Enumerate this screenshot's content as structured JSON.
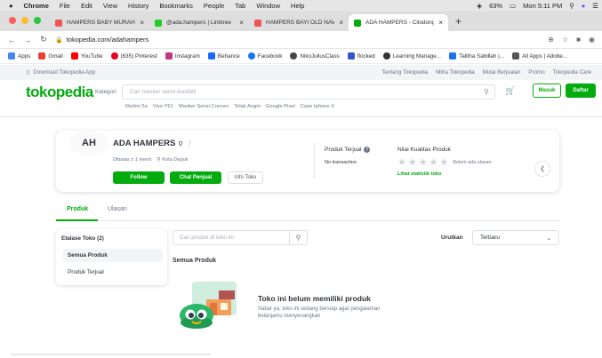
{
  "mac_menu": {
    "apple": "",
    "items": [
      "Chrome",
      "File",
      "Edit",
      "View",
      "History",
      "Bookmarks",
      "People",
      "Tab",
      "Window",
      "Help"
    ],
    "battery": "63%",
    "clock": "Mon 5:11 PM"
  },
  "browser": {
    "tabs": [
      {
        "title": "HAMPERS BABY MURAH BERK",
        "color": "#e55"
      },
      {
        "title": "@ada.hampers | Linktree",
        "color": "#2c2"
      },
      {
        "title": "HAMPERS BAYI OLD NAVY MU",
        "color": "#e55"
      },
      {
        "title": "ADA HAMPERS - Cilodong, Ko",
        "color": "#03ac0e"
      }
    ],
    "url": "tokopedia.com/adahampers",
    "bookmarks": [
      {
        "label": "Apps",
        "color": "#4285f4"
      },
      {
        "label": "Gmail",
        "color": "#ea4335"
      },
      {
        "label": "YouTube",
        "color": "#ff0000"
      },
      {
        "label": "(635) Pinterest",
        "color": "#e60023"
      },
      {
        "label": "Instagram",
        "color": "#c13584"
      },
      {
        "label": "Behance",
        "color": "#1769ff"
      },
      {
        "label": "Facebook",
        "color": "#1877f2"
      },
      {
        "label": "NikoJuliusClass",
        "color": "#444"
      },
      {
        "label": "flocked",
        "color": "#3355cc"
      },
      {
        "label": "Learning Manage...",
        "color": "#333"
      },
      {
        "label": "Talitha Sabillah |...",
        "color": "#1a73e8"
      },
      {
        "label": "All Apps | Adobe...",
        "color": "#555"
      }
    ]
  },
  "topbar": {
    "download": "Download Tokopedia App",
    "links": [
      "Tentang Tokopedia",
      "Mitra Tokopedia",
      "Mulai Berjualan",
      "Promo",
      "Tokopedia Care"
    ]
  },
  "header": {
    "logo": "tokopedia",
    "kategori": "Kategori",
    "search_placeholder": "Cari masker sensi duckbill",
    "masuk": "Masuk",
    "daftar": "Daftar",
    "keywords": [
      "Redmi 5a",
      "Vivo Y51",
      "Masker Sensi Convex",
      "Tolak Angin",
      "Google Pixel",
      "Case Iphone X"
    ]
  },
  "shop": {
    "avatar": "AH",
    "name": "ADA HAMPERS",
    "status": "Dibalas ± 1 menit",
    "location": "Kota Depok",
    "follow": "Follow",
    "chat": "Chat Penjual",
    "info": "Info Toko",
    "produk_terjual_label": "Produk Terjual",
    "produk_terjual_value": "No transaction",
    "nilai_label": "Nilai Kualitas Produk",
    "nilai_value": "Belum ada ulasan",
    "lihat": "Lihat statistik toko"
  },
  "page_tabs": {
    "produk": "Produk",
    "ulasan": "Ulasan"
  },
  "etalase": {
    "title": "Etalase Toko (2)",
    "items": [
      "Semua Produk",
      "Produk Terjual"
    ]
  },
  "products": {
    "search_placeholder": "Cari produk di toko ini",
    "section_title": "Semua Produk",
    "sort_label": "Urutkan",
    "sort_value": "Terbaru",
    "empty_title": "Toko ini belum memiliki produk",
    "empty_sub": "Sabar ya, toko ini sedang bersiap agar pengalaman belanjamu menyenangkan"
  }
}
